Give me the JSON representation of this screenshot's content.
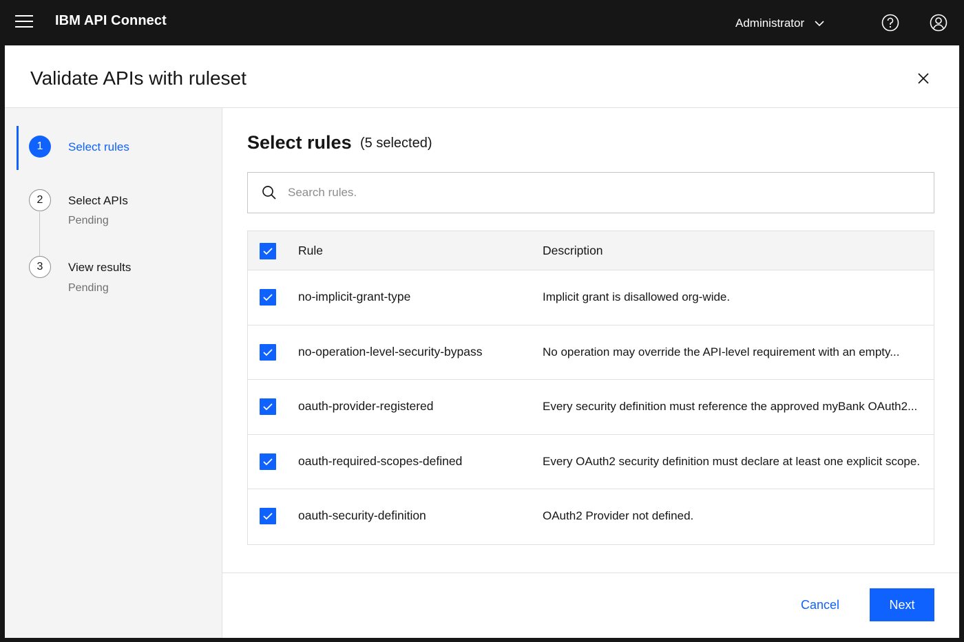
{
  "header": {
    "brand_bold": "IBM API Connect",
    "user_label": "Administrator"
  },
  "modal": {
    "title": "Validate APIs with ruleset"
  },
  "progress": {
    "steps": [
      {
        "number": "1",
        "label": "Select rules",
        "status": "",
        "state": "active"
      },
      {
        "number": "2",
        "label": "Select APIs",
        "status": "Pending",
        "state": "pending"
      },
      {
        "number": "3",
        "label": "View results",
        "status": "Pending",
        "state": "pending"
      }
    ]
  },
  "content": {
    "title": "Select rules",
    "selected_count": "(5 selected)",
    "search_placeholder": "Search rules.",
    "table": {
      "headers": {
        "rule": "Rule",
        "description": "Description"
      },
      "rows": [
        {
          "rule": "no-implicit-grant-type",
          "description": "Implicit grant is disallowed org-wide.",
          "checked": true
        },
        {
          "rule": "no-operation-level-security-bypass",
          "description": "No operation may override the API-level requirement with an empty...",
          "checked": true
        },
        {
          "rule": "oauth-provider-registered",
          "description": "Every security definition must reference the approved myBank OAuth2...",
          "checked": true
        },
        {
          "rule": "oauth-required-scopes-defined",
          "description": "Every OAuth2 security definition must declare at least one explicit scope.",
          "checked": true
        },
        {
          "rule": "oauth-security-definition",
          "description": "OAuth2 Provider not defined.",
          "checked": true
        }
      ]
    }
  },
  "footer": {
    "cancel_label": "Cancel",
    "next_label": "Next"
  },
  "colors": {
    "accent": "#0f62fe",
    "header_bg": "#161616",
    "panel_bg": "#f4f4f4"
  }
}
